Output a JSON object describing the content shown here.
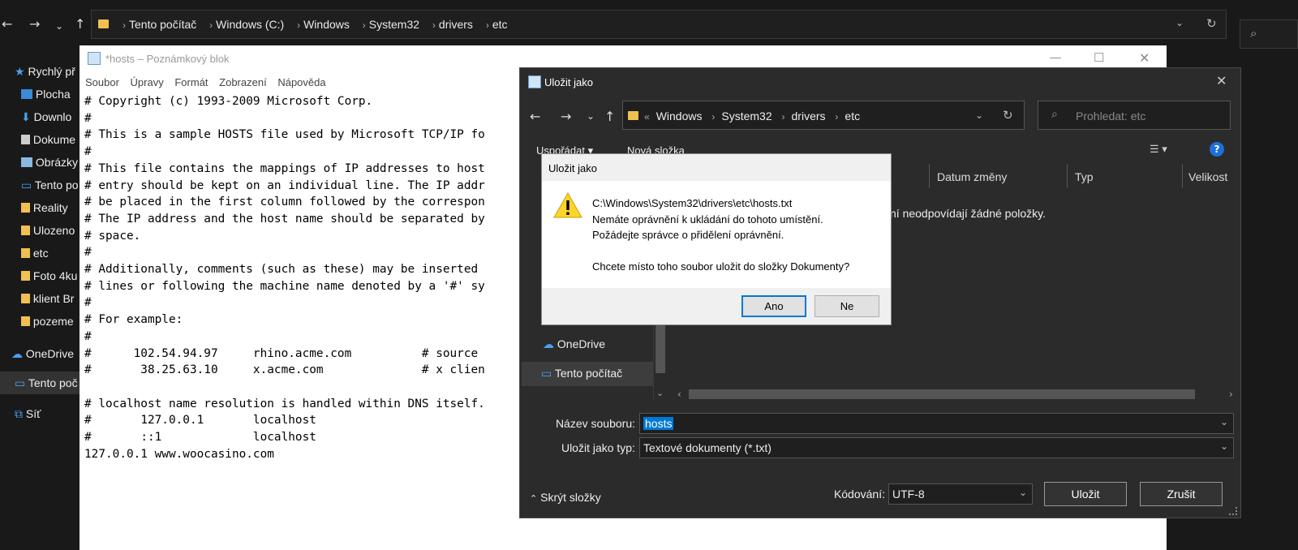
{
  "explorer": {
    "breadcrumbs": [
      "Tento počítač",
      "Windows (C:)",
      "Windows",
      "System32",
      "drivers",
      "etc"
    ],
    "sidebar": [
      {
        "label": "Rychlý př",
        "icon": "star-icon"
      },
      {
        "label": "Plocha",
        "icon": "desktop-icon"
      },
      {
        "label": "Downlo",
        "icon": "download-icon"
      },
      {
        "label": "Dokume",
        "icon": "document-icon"
      },
      {
        "label": "Obrázky",
        "icon": "pictures-icon"
      },
      {
        "label": "Tento po",
        "icon": "computer-icon"
      },
      {
        "label": "Reality",
        "icon": "folder-icon"
      },
      {
        "label": "Ulozeno",
        "icon": "folder-icon"
      },
      {
        "label": "etc",
        "icon": "folder-icon"
      },
      {
        "label": "Foto 4ku",
        "icon": "folder-icon"
      },
      {
        "label": "klient Br",
        "icon": "folder-icon"
      },
      {
        "label": "pozeme",
        "icon": "folder-icon"
      },
      {
        "label": "OneDrive",
        "icon": "cloud-icon"
      },
      {
        "label": "Tento poč",
        "icon": "computer-icon"
      },
      {
        "label": "Síť",
        "icon": "network-icon"
      }
    ]
  },
  "notepad": {
    "title": "*hosts – Poznámkový blok",
    "menu": [
      "Soubor",
      "Úpravy",
      "Formát",
      "Zobrazení",
      "Nápověda"
    ],
    "text": "# Copyright (c) 1993-2009 Microsoft Corp.\n#\n# This is a sample HOSTS file used by Microsoft TCP/IP fo\n#\n# This file contains the mappings of IP addresses to host\n# entry should be kept on an individual line. The IP addr\n# be placed in the first column followed by the correspon\n# The IP address and the host name should be separated by\n# space.\n#\n# Additionally, comments (such as these) may be inserted \n# lines or following the machine name denoted by a '#' sy\n#\n# For example:\n#\n#      102.54.94.97     rhino.acme.com          # source \n#       38.25.63.10     x.acme.com              # x clien\n\n# localhost name resolution is handled within DNS itself.\n#\t127.0.0.1       localhost\n#\t::1             localhost\n127.0.0.1 www.woocasino.com"
  },
  "saveas": {
    "title": "Uložit jako",
    "breadcrumbs": [
      "Windows",
      "System32",
      "drivers",
      "etc"
    ],
    "search_placeholder": "Prohledat: etc",
    "organize": "Uspořádat ▾",
    "new_folder": "Nová složka",
    "columns": [
      "Datum změny",
      "Typ",
      "Velikost"
    ],
    "empty_message": "ní neodpovídají žádné položky.",
    "nav_pane": [
      "OneDrive",
      "Tento počítač"
    ],
    "filename_label": "Název souboru:",
    "filename_value": "hosts",
    "filetype_label": "Uložit jako typ:",
    "filetype_value": "Textové dokumenty (*.txt)",
    "encoding_label": "Kódování:",
    "encoding_value": "UTF-8",
    "save_button": "Uložit",
    "cancel_button": "Zrušit",
    "hide_folders": "Skrýt složky"
  },
  "msgbox": {
    "title": "Uložit jako",
    "line1": "C:\\Windows\\System32\\drivers\\etc\\hosts.txt",
    "line2": "Nemáte oprávnění k ukládání do tohoto umístění.",
    "line3": "Požádejte správce o přidělení oprávnění.",
    "line4": "Chcete místo toho soubor uložit do složky Dokumenty?",
    "yes": "Ano",
    "no": "Ne"
  },
  "colors": {
    "accent": "#0078d7",
    "folder": "#f0c050",
    "dark_bg": "#191919",
    "dialog_bg": "#2b2b2b"
  }
}
